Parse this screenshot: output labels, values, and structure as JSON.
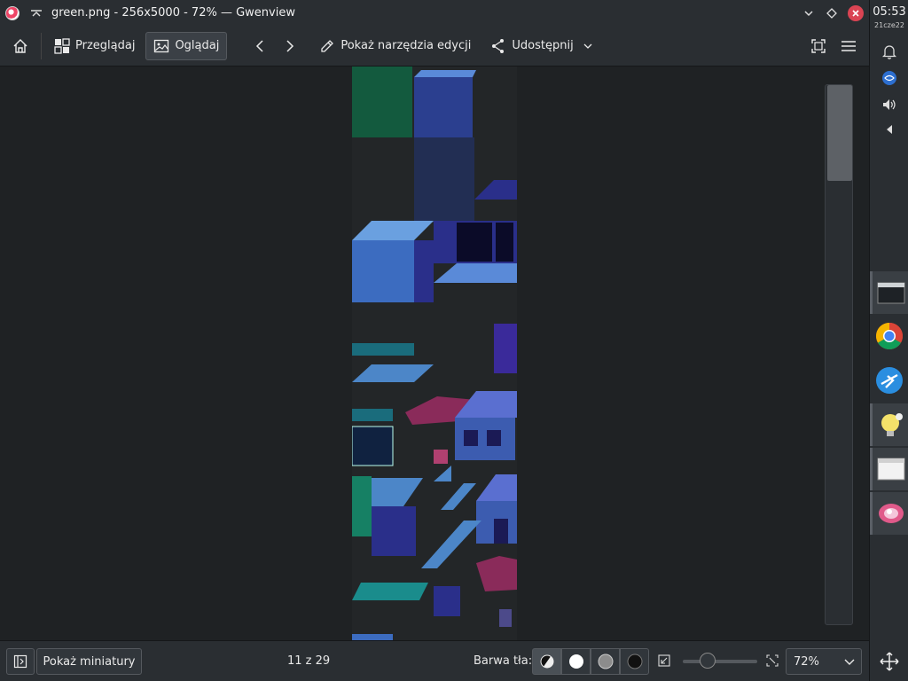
{
  "window": {
    "title": "green.png - 256x5000 - 72% — Gwenview",
    "icon": "gwenview-app-icon"
  },
  "toolbar": {
    "home_icon": "home-icon",
    "browse_label": "Przeglądaj",
    "view_label": "Oglądaj",
    "edit_tools_label": "Pokaż narzędzia edycji",
    "share_label": "Udostępnij"
  },
  "statusbar": {
    "thumbnails_label": "Pokaż miniatury",
    "position": "11 z 29",
    "bg_color_label": "Barwa tła:",
    "zoom_value": "72%",
    "zoom_level": 0.72
  },
  "system_panel": {
    "time": "05:53",
    "date": "21cze22"
  },
  "colors": {
    "accent_close": "#da4453",
    "panel_bg": "#2a2e32",
    "viewport_bg": "#1f2224"
  }
}
